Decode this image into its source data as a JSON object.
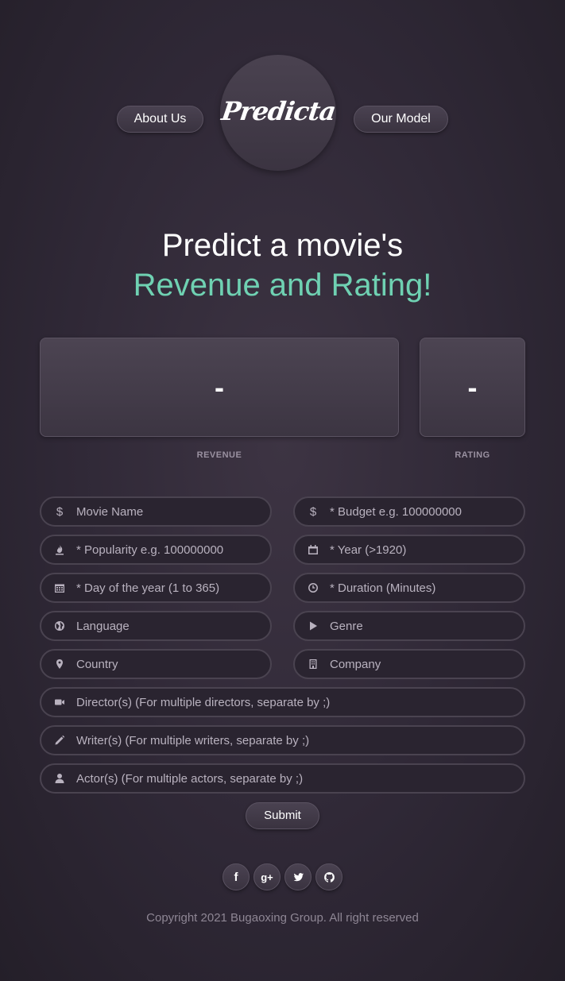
{
  "nav": {
    "about_label": "About Us",
    "logo_text": "Predicta",
    "model_label": "Our Model"
  },
  "headline": {
    "line1": "Predict a movie's",
    "line2": "Revenue and Rating!"
  },
  "results": {
    "revenue_value": "-",
    "rating_value": "-",
    "revenue_label": "REVENUE",
    "rating_label": "RATING"
  },
  "form": {
    "movie_name": {
      "placeholder": "Movie Name",
      "value": "",
      "icon": "dollar-icon"
    },
    "budget": {
      "placeholder": "* Budget e.g. 100000000",
      "value": "",
      "icon": "dollar-icon"
    },
    "popularity": {
      "placeholder": "* Popularity e.g. 100000000",
      "value": "",
      "icon": "fire-icon"
    },
    "year": {
      "placeholder": "* Year (>1920)",
      "value": "",
      "icon": "calendar-icon"
    },
    "day_of_year": {
      "placeholder": "* Day of the year (1 to 365)",
      "value": "",
      "icon": "calendar-grid-icon"
    },
    "duration": {
      "placeholder": "* Duration (Minutes)",
      "value": "",
      "icon": "clock-icon"
    },
    "language": {
      "placeholder": "Language",
      "value": "",
      "icon": "globe-icon"
    },
    "genre": {
      "placeholder": "Genre",
      "value": "",
      "icon": "play-icon"
    },
    "country": {
      "placeholder": "Country",
      "value": "",
      "icon": "map-marker-icon"
    },
    "company": {
      "placeholder": "Company",
      "value": "",
      "icon": "building-icon"
    },
    "directors": {
      "placeholder": "Director(s) (For multiple directors, separate by ;)",
      "value": "",
      "icon": "video-camera-icon"
    },
    "writers": {
      "placeholder": "Writer(s) (For multiple writers, separate by ;)",
      "value": "",
      "icon": "pencil-icon"
    },
    "actors": {
      "placeholder": "Actor(s) (For multiple actors, separate by ;)",
      "value": "",
      "icon": "user-icon"
    },
    "submit_label": "Submit"
  },
  "footer": {
    "social": [
      "facebook-icon",
      "google-plus-icon",
      "twitter-icon",
      "github-icon"
    ],
    "facebook_glyph": "f",
    "google_glyph": "g+",
    "copyright": "Copyright 2021 Bugaoxing Group. All right reserved"
  },
  "colors": {
    "accent": "#6fd1b2",
    "background": "#2f2836",
    "field_background": "#2a2430"
  }
}
